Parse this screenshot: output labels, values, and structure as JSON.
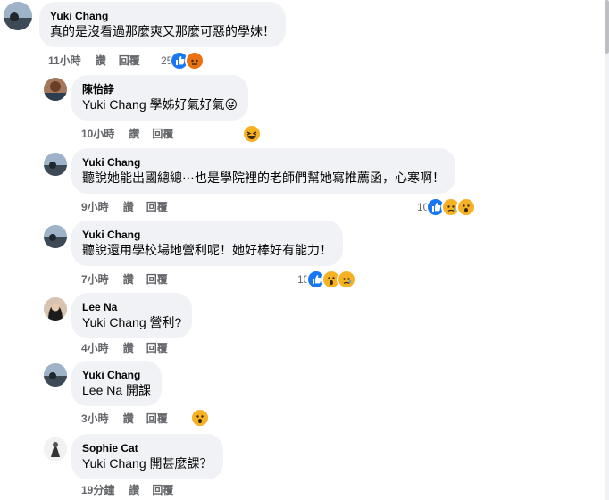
{
  "comments": [
    {
      "author": "Yuki Chang",
      "tag": "",
      "text": "真的是沒看過那麼爽又那麼可惡的學妹！",
      "time": "11小時",
      "like": "讚",
      "reply": "回覆",
      "reaction_count": "25",
      "reactions": [
        "like",
        "angry"
      ]
    },
    {
      "author": "陳怡諍",
      "tag": "Yuki Chang",
      "text": " 學姊好氣好氣😜",
      "time": "10小時",
      "like": "讚",
      "reply": "回覆",
      "reaction_count": "",
      "reactions": [
        "haha"
      ]
    },
    {
      "author": "Yuki Chang",
      "tag": "",
      "text": "聽說她能出國總總⋯也是學院裡的老師們幫她寫推薦函，心寒啊！",
      "time": "9小時",
      "like": "讚",
      "reply": "回覆",
      "reaction_count": "10",
      "reactions": [
        "like",
        "sad",
        "wow"
      ]
    },
    {
      "author": "Yuki Chang",
      "tag": "",
      "text": "聽說還用學校場地營利呢！她好棒好有能力！",
      "time": "7小時",
      "like": "讚",
      "reply": "回覆",
      "reaction_count": "10",
      "reactions": [
        "like",
        "wow",
        "sad"
      ]
    },
    {
      "author": "Lee Na",
      "tag": "Yuki Chang",
      "text": " 營利?",
      "time": "4小時",
      "like": "讚",
      "reply": "回覆",
      "reaction_count": "",
      "reactions": []
    },
    {
      "author": "Yuki Chang",
      "tag": "Lee Na",
      "text": " 開課",
      "time": "3小時",
      "like": "讚",
      "reply": "回覆",
      "reaction_count": "",
      "reactions": [
        "wow"
      ]
    },
    {
      "author": "Sophie Cat",
      "tag": "Yuki Chang",
      "text": " 開甚麼課？",
      "time": "19分鐘",
      "like": "讚",
      "reply": "回覆",
      "reaction_count": "",
      "reactions": []
    }
  ]
}
